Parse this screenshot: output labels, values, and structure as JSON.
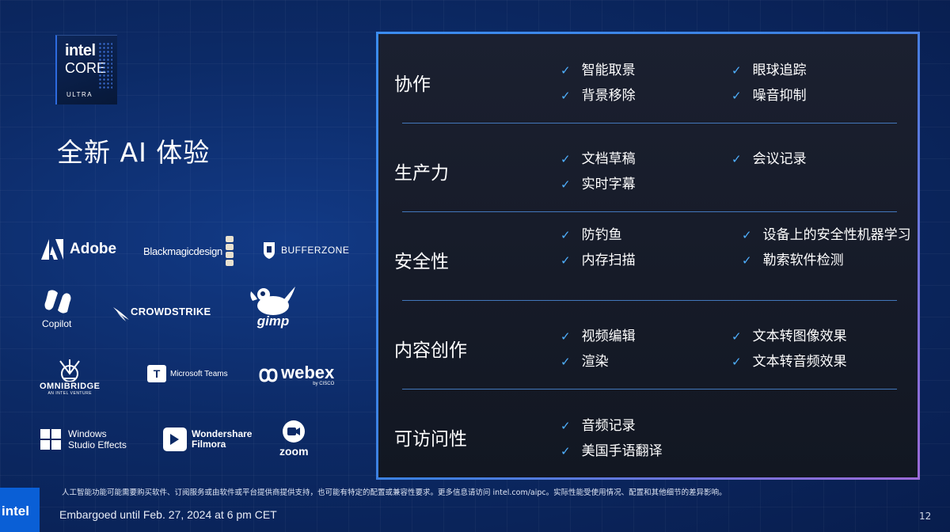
{
  "badge": {
    "line1": "intel",
    "line2": "CORE",
    "line3": "ULTRA"
  },
  "title": "全新 AI 体验",
  "logos": {
    "adobe": "Adobe",
    "blackmagic": "Blackmagicdesign",
    "bufferzone": "BUFFERZONE",
    "copilot": "Copilot",
    "crowdstrike": "CROWDSTRIKE",
    "gimp": "gimp",
    "omnibridge": "OMNIBRIDGE",
    "omnibridge_sub": "AN INTEL VENTURE",
    "msteams": "Microsoft Teams",
    "webex": "webex",
    "webex_sub": "by CISCO",
    "windows_line1": "Windows",
    "windows_line2": "Studio Effects",
    "filmora_line1": "Wondershare",
    "filmora_line2": "Filmora",
    "zoom": "zoom"
  },
  "check": "✓",
  "categories": [
    {
      "name": "协作",
      "items": [
        "智能取景",
        "背景移除",
        "眼球追踪",
        "噪音抑制"
      ]
    },
    {
      "name": "生产力",
      "items": [
        "文档草稿",
        "实时字幕",
        "会议记录"
      ]
    },
    {
      "name": "安全性",
      "items": [
        "防钓鱼",
        "内存扫描",
        "设备上的安全性机器学习",
        "勒索软件检测"
      ]
    },
    {
      "name": "内容创作",
      "items": [
        "视频编辑",
        "渲染",
        "文本转图像效果",
        "文本转音频效果"
      ]
    },
    {
      "name": "可访问性",
      "items": [
        "音频记录",
        "美国手语翻译"
      ]
    }
  ],
  "footnote": "人工智能功能可能需要购买软件、订阅服务或由软件或平台提供商提供支持，也可能有特定的配置或兼容性要求。更多信息请访问 intel.com/aipc。实际性能受使用情况、配置和其他细节的差异影响。",
  "footer": {
    "logo": "intel",
    "embargo": "Embargoed until Feb. 27, 2024 at 6 pm CET",
    "page": "12"
  },
  "colors": {
    "accent": "#4fb0ff",
    "panel_border": "#3d86e6",
    "background": "#0c2a66"
  }
}
